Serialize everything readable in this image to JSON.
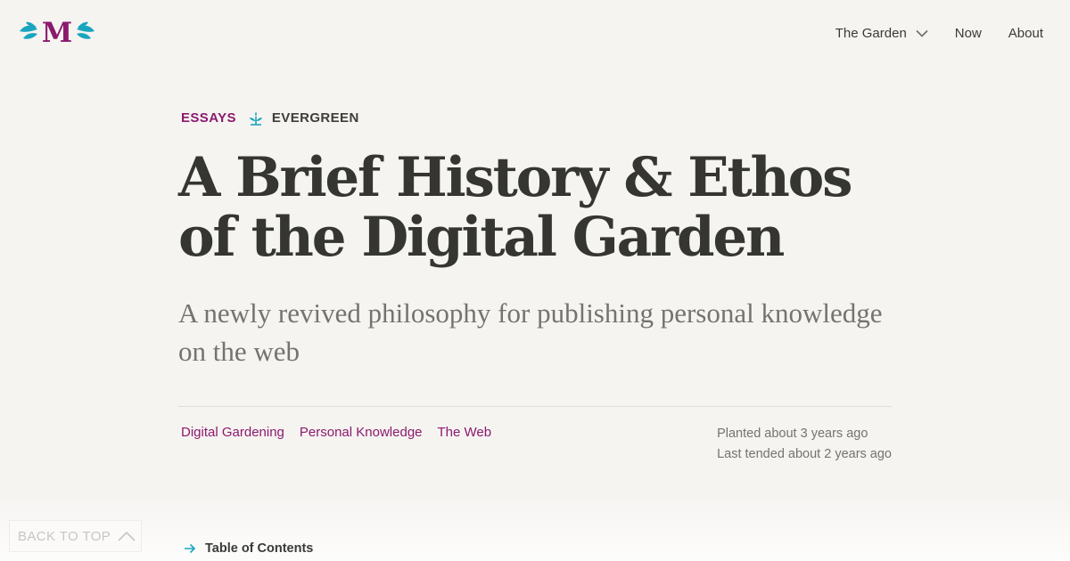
{
  "logo": {
    "letter": "M",
    "brand_color": "#8b1a6e",
    "leaf_color": "#1aa5bf"
  },
  "nav": {
    "items": [
      {
        "label": "The Garden",
        "has_dropdown": true
      },
      {
        "label": "Now"
      },
      {
        "label": "About"
      }
    ]
  },
  "article": {
    "category": "ESSAYS",
    "stage_icon": "sprout-icon",
    "stage": "EVERGREEN",
    "title": "A Brief History & Ethos of the Digital Garden",
    "subtitle": "A newly revived philosophy for publishing personal knowledge on the web",
    "tags": [
      "Digital Gardening",
      "Personal Knowledge",
      "The Web"
    ],
    "planted": "Planted about 3 years ago",
    "tended": "Last tended about 2 years ago",
    "toc_label": "Table of Contents"
  },
  "back_to_top": {
    "label": "BACK TO TOP"
  },
  "colors": {
    "background": "#f6f4f1",
    "accent": "#8b1a6e",
    "teal": "#1aa5bf",
    "text": "#353531",
    "muted": "#75736f"
  }
}
